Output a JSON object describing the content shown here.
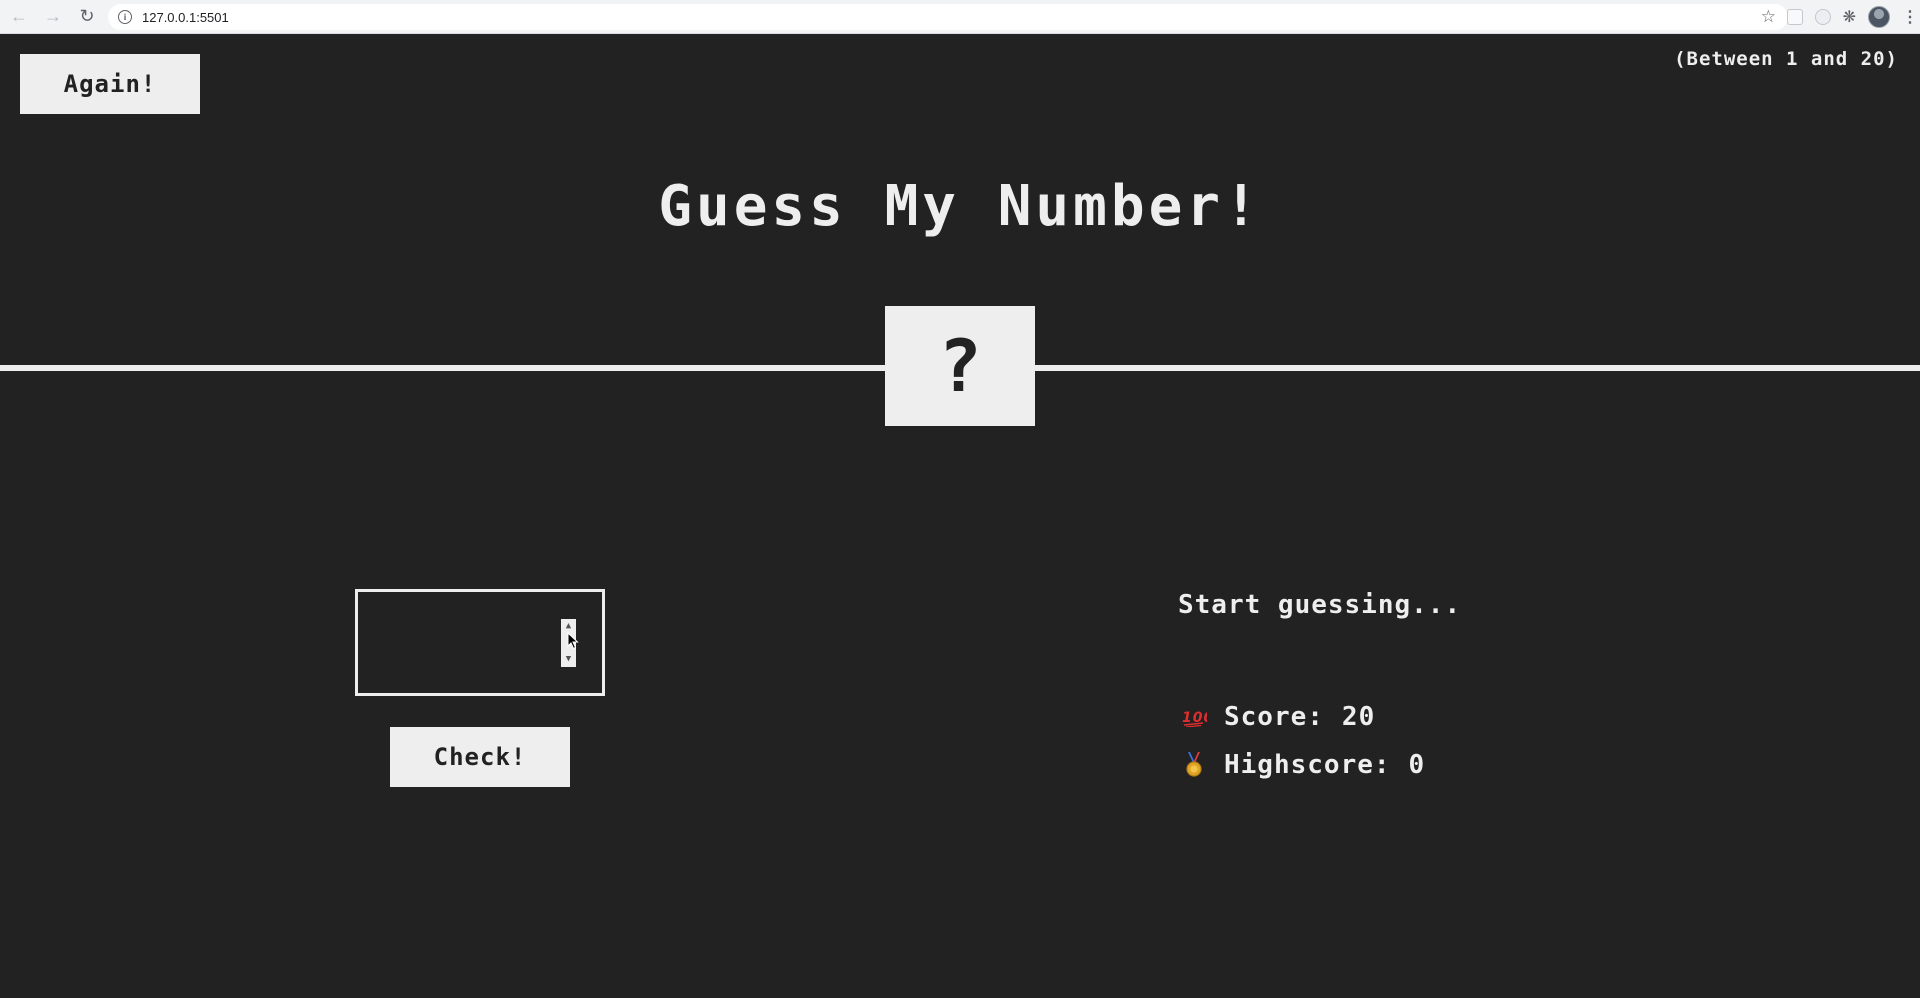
{
  "browser": {
    "url": "127.0.0.1:5501",
    "back_icon": "back-arrow-icon",
    "forward_icon": "forward-arrow-icon",
    "reload_icon": "reload-icon"
  },
  "game": {
    "again_label": "Again!",
    "between_text": "(Between 1 and 20)",
    "title": "Guess My Number!",
    "secret_number": "?",
    "guess_value": "",
    "check_label": "Check!",
    "message": "Start guessing...",
    "score_label": "Score:",
    "score_value": "20",
    "highscore_label": "Highscore:",
    "highscore_value": "0"
  },
  "colors": {
    "background": "#222222",
    "foreground": "#eeeeee"
  }
}
